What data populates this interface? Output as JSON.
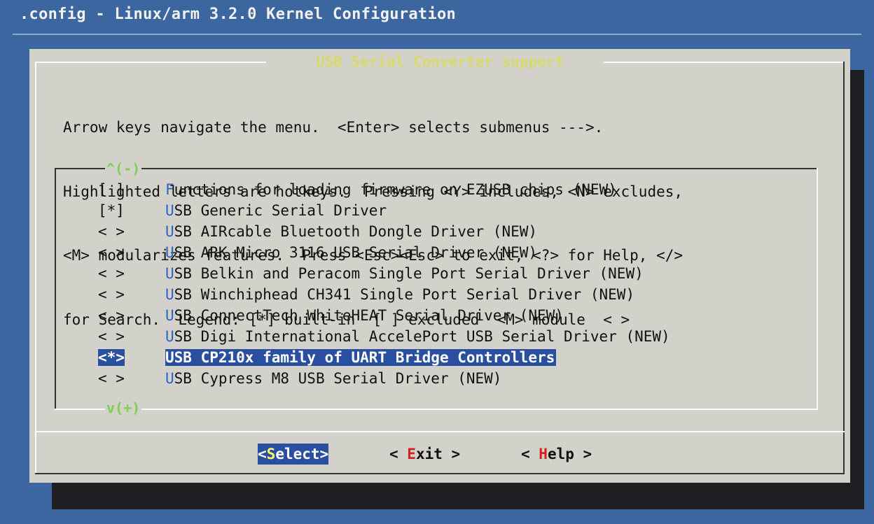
{
  "window_title": ".config - Linux/arm 3.2.0 Kernel Configuration",
  "dialog_title": "USB Serial Converter support",
  "help_lines": [
    "Arrow keys navigate the menu.  <Enter> selects submenus --->.",
    "Highlighted letters are hotkeys.  Pressing <Y> includes, <N> excludes,",
    "<M> modularizes features.  Press <Esc><Esc> to exit, <?> for Help, </>",
    "for Search.  Legend: [*] built-in  [ ] excluded  <M> module  < >"
  ],
  "scroll_up": "^(-)",
  "scroll_down": "v(+)",
  "items": [
    {
      "state": "[ ]",
      "hotkey": "F",
      "rest": "unctions for loading firmware on EZUSB chips (NEW)"
    },
    {
      "state": "[*]",
      "hotkey": "U",
      "rest": "SB Generic Serial Driver"
    },
    {
      "state": "< >",
      "hotkey": "U",
      "rest": "SB AIRcable Bluetooth Dongle Driver (NEW)"
    },
    {
      "state": "< >",
      "hotkey": "U",
      "rest": "SB ARK Micro 3116 USB Serial Driver (NEW)"
    },
    {
      "state": "< >",
      "hotkey": "U",
      "rest": "SB Belkin and Peracom Single Port Serial Driver (NEW)"
    },
    {
      "state": "< >",
      "hotkey": "U",
      "rest": "SB Winchiphead CH341 Single Port Serial Driver (NEW)"
    },
    {
      "state": "< >",
      "hotkey": "U",
      "rest": "SB ConnectTech WhiteHEAT Serial Driver (NEW)"
    },
    {
      "state": "< >",
      "hotkey": "U",
      "rest": "SB Digi International AccelePort USB Serial Driver (NEW)"
    },
    {
      "state": "<*>",
      "hotkey": "U",
      "rest": "SB CP210x family of UART Bridge Controllers",
      "selected": true
    },
    {
      "state": "< >",
      "hotkey": "U",
      "rest": "SB Cypress M8 USB Serial Driver (NEW)"
    }
  ],
  "buttons": {
    "select": {
      "open": "<",
      "hotkey": "S",
      "rest": "elect>"
    },
    "exit": {
      "open": "< ",
      "hotkey": "E",
      "rest": "xit >"
    },
    "help": {
      "open": "< ",
      "hotkey": "H",
      "rest": "elp >"
    }
  },
  "colors": {
    "background": "#3b66a0",
    "dialog": "#d2d2cb",
    "title_yellow": "#d9d96a",
    "hotkey_blue": "#2f63c4",
    "selection": "#2a4fa0",
    "scroll_green": "#7fcf4f"
  }
}
